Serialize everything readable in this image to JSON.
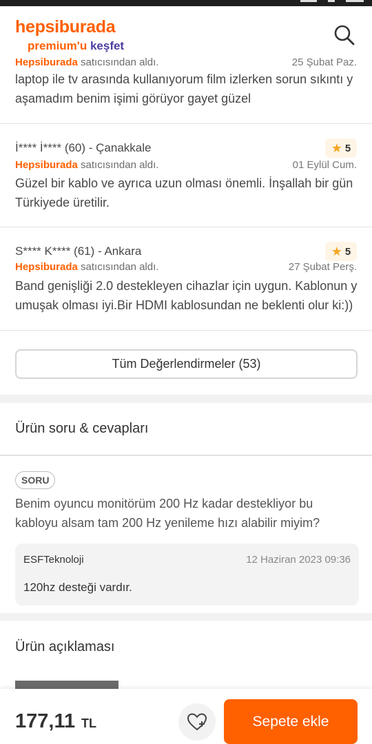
{
  "header": {
    "logo_main": "hepsiburada",
    "logo_sub_orange": "premium'u ",
    "logo_sub_dark": "keşfet",
    "search_icon": "search-icon"
  },
  "reviews": [
    {
      "name": "",
      "seller_brand": "Hepsiburada",
      "seller_suffix": " satıcısından aldı.",
      "date": "25 Şubat Paz.",
      "text": "laptop ile tv arasında kullanıyorum film izlerken sorun sıkıntı y aşamadım benim işimi görüyor gayet güzel",
      "rating": ""
    },
    {
      "name": "İ**** İ**** (60) - Çanakkale",
      "seller_brand": "Hepsiburada",
      "seller_suffix": " satıcısından aldı.",
      "date": "01 Eylül Cum.",
      "text": "Güzel bir kablo ve ayrıca uzun olması önemli. İnşallah bir gün Türkiyede üretilir.",
      "rating": "5"
    },
    {
      "name": "S**** K**** (61) - Ankara",
      "seller_brand": "Hepsiburada",
      "seller_suffix": " satıcısından aldı.",
      "date": "27 Şubat Perş.",
      "text": "Band genişliği 2.0 destekleyen cihazlar için uygun. Kablonun y umuşak olması iyi.Bir HDMI kablosundan ne beklenti olur ki:))",
      "rating": "5"
    }
  ],
  "all_reviews_label": "Tüm Değerlendirmeler (53)",
  "qa": {
    "title": "Ürün soru & cevapları",
    "badge": "SORU",
    "question": "Benim oyuncu monitörüm 200 Hz kadar destekliyor bu kabloyu alsam tam 200 Hz yenileme hızı alabilir miyim?",
    "answer_seller": "ESFTeknoloji",
    "answer_date": "12 Haziran 2023 09:36",
    "answer_text": "120hz desteği vardır."
  },
  "description": {
    "title": "Ürün açıklaması"
  },
  "bottom": {
    "price": "177,11",
    "currency": "TL",
    "favorite_icon": "heart-icon",
    "cart_label": "Sepete ekle"
  },
  "colors": {
    "brand_orange": "#ff6000",
    "star": "#f5a623"
  }
}
